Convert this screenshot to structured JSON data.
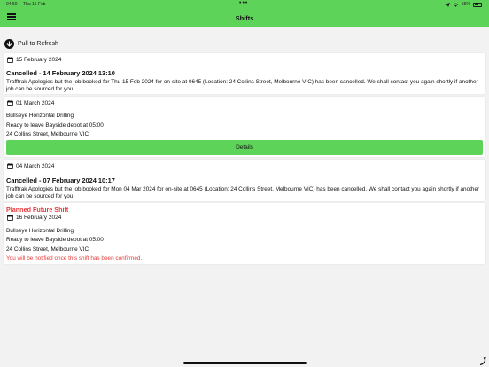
{
  "status": {
    "time": "04:50",
    "date": "Thu 15 Feb",
    "battery": "55%",
    "battery_level": 0.55
  },
  "header": {
    "title": "Shifts"
  },
  "refresh": {
    "label": "Pull to Refresh"
  },
  "shifts": [
    {
      "date": "15 February 2024",
      "title": "Cancelled - 14 February 2024 13:10",
      "message": "Trafftrak  Apologies but the job booked for Thu 15 Feb 2024 for on-site at 0645 (Location: 24 Collins Street, Melbourne VIC) has been cancelled.  We shall contact you again shortly if another job can be sourced for you."
    },
    {
      "date": "01 March 2024",
      "company": "Bullseye Horizontal Drilling",
      "depart": "Ready to leave Bayside depot at 05:00",
      "location": "24 Collins Street, Melbourne VIC",
      "button": "Details"
    },
    {
      "date": "04 March 2024",
      "title": "Cancelled - 07 February 2024 10:17",
      "message": "Trafftrak  Apologies but the job booked for Mon 04 Mar 2024 for on-site at 0645 (Location: 24 Collins Street, Melbourne VIC) has been cancelled.  We shall contact you again shortly if another job can be sourced for you."
    },
    {
      "status": "Planned Future Shift",
      "date": "16 February 2024",
      "company": "Bullseye Horizontal Drilling",
      "depart": "Ready to leave Bayside depot at 05:00",
      "location": "24 Collins Street, Melbourne VIC",
      "notice": "You will be notified once this shift has been confirmed."
    }
  ],
  "colors": {
    "accent": "#5ed35a",
    "warning": "#e63a3a",
    "background": "#f2f2f2"
  },
  "icons": [
    "menu-icon",
    "wifi-icon",
    "battery-icon",
    "arrow-down-circle-icon",
    "calendar-icon"
  ]
}
